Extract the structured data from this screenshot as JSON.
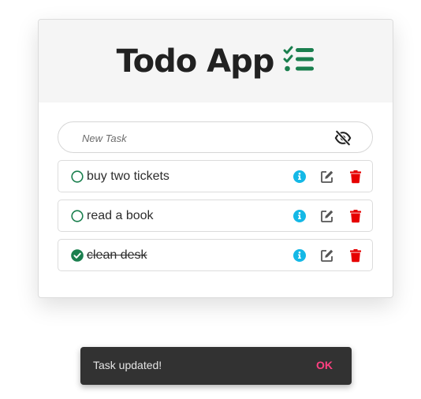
{
  "app": {
    "title": "Todo App",
    "title_icon": "list-check-icon"
  },
  "new_task": {
    "placeholder": "New Task",
    "value": "",
    "toggle_icon": "eye-slash-icon"
  },
  "tasks": [
    {
      "label": "buy two tickets",
      "completed": false
    },
    {
      "label": "read a book",
      "completed": false
    },
    {
      "label": "clean desk",
      "completed": true
    }
  ],
  "task_actions": {
    "info_icon": "info-circle-icon",
    "edit_icon": "edit-icon",
    "delete_icon": "trash-icon"
  },
  "snackbar": {
    "message": "Task updated!",
    "action_label": "OK"
  },
  "colors": {
    "accent_green": "#1a7f4e",
    "info_blue": "#14b8e6",
    "delete_red": "#e60000",
    "snackbar_action": "#ff4081"
  }
}
